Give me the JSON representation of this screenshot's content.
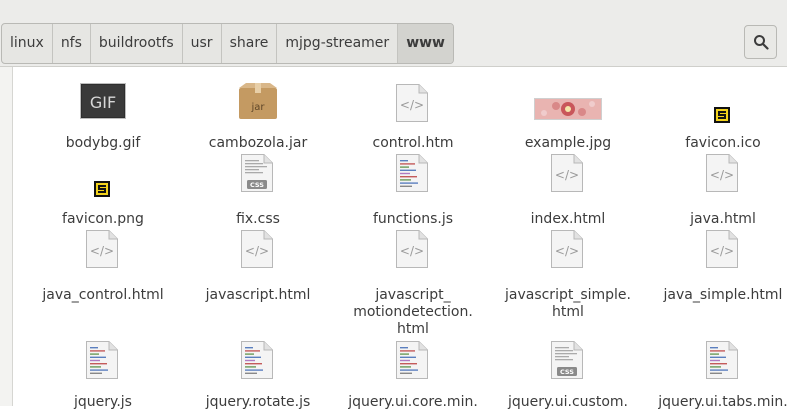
{
  "breadcrumb": [
    "linux",
    "nfs",
    "buildrootfs",
    "usr",
    "share",
    "mjpg-streamer",
    "www"
  ],
  "files": [
    {
      "name": "bodybg.gif",
      "icon": "gif-icon"
    },
    {
      "name": "cambozola.jar",
      "icon": "jar-icon"
    },
    {
      "name": "control.htm",
      "icon": "html-icon"
    },
    {
      "name": "example.jpg",
      "icon": "image-thumbnail-icon"
    },
    {
      "name": "favicon.ico",
      "icon": "favicon-icon"
    },
    {
      "name": "favicon.png",
      "icon": "favicon-icon"
    },
    {
      "name": "fix.css",
      "icon": "css-icon"
    },
    {
      "name": "functions.js",
      "icon": "javascript-icon"
    },
    {
      "name": "index.html",
      "icon": "html-icon"
    },
    {
      "name": "java.html",
      "icon": "html-icon"
    },
    {
      "name": "java_control.html",
      "icon": "html-icon"
    },
    {
      "name": "javascript.html",
      "icon": "html-icon"
    },
    {
      "name": "javascript_\nmotiondetection.\nhtml",
      "icon": "html-icon"
    },
    {
      "name": "javascript_simple.\nhtml",
      "icon": "html-icon"
    },
    {
      "name": "java_simple.html",
      "icon": "html-icon"
    },
    {
      "name": "jquery.js",
      "icon": "javascript-icon"
    },
    {
      "name": "jquery.rotate.js",
      "icon": "javascript-icon"
    },
    {
      "name": "jquery.ui.core.min.",
      "icon": "javascript-icon"
    },
    {
      "name": "jquery.ui.custom.",
      "icon": "css-icon"
    },
    {
      "name": "jquery.ui.tabs.min.",
      "icon": "javascript-icon"
    }
  ],
  "gif_icon_text": "GIF",
  "jar_icon_text": "jar",
  "css_icon_text": "CSS"
}
